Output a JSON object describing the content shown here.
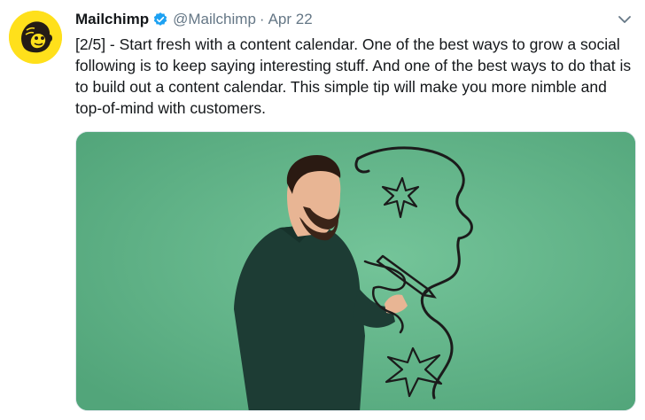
{
  "tweet": {
    "author_name": "Mailchimp",
    "verified": true,
    "handle": "@Mailchimp",
    "separator": "·",
    "date": "Apr 22",
    "text": "[2/5] - Start fresh with a content calendar. One of the best ways to grow a social following is to keep saying interesting stuff. And one of the best ways to do that is to build out a content calendar. This simple tip will make you more nimble and top-of-mind with customers.",
    "icons": {
      "avatar": "mailchimp-freddie-avatar",
      "verified": "verified-badge-icon",
      "menu": "chevron-down-icon"
    },
    "colors": {
      "avatar_bg": "#ffe01b",
      "verified": "#1da1f2",
      "media_bg": "#63b68a",
      "muted_text": "#657786"
    }
  }
}
